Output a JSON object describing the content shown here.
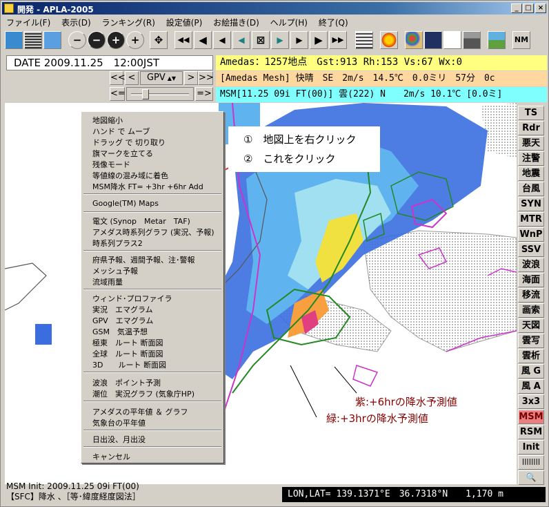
{
  "window": {
    "title": "開発 - APLA-2005"
  },
  "menu": [
    "ファイル(F)",
    "表示(D)",
    "ランキング(R)",
    "設定値(P)",
    "お絵描き(D)",
    "ヘルプ(H)",
    "終了(Q)"
  ],
  "toolbar_glyphs": {
    "zoom_out": "−",
    "minus": "−",
    "plus": "+",
    "plus2": "+",
    "center": "✥",
    "first": "◀◀",
    "prev_big": "◀",
    "prev": "◀",
    "prev_small": "◀",
    "stop": "⊠",
    "next_small": "▶",
    "next": "▶",
    "next_big": "▶",
    "last": "▶▶",
    "nm": "NM"
  },
  "date": "DATE 2009.11.25　12:00JST",
  "amedas": {
    "line1": "Amedas：1257地点　Gst:913 Rh:153 Vs:67 Wx:0",
    "line2": "[Amedas Mesh] 快晴　SE　2m/s　14.5℃　0.0ミリ　57分　0c",
    "msm": "MSM[11.25 09i FT(00)] 雲(222) N　　2m/s 10.1℃ [0.0ミ]"
  },
  "gpv": {
    "first": "<<",
    "prev": "<",
    "label": "GPV",
    "next": ">",
    "last": ">>",
    "slider_left": "<=",
    "slider_right": "=>"
  },
  "side_buttons": [
    "TS",
    "Rdr",
    "悪天",
    "注警",
    "地震",
    "台風",
    "SYN",
    "MTR",
    "WnP",
    "SSV",
    "波浪",
    "海面",
    "移流",
    "画索",
    "天図",
    "雲写",
    "雲析",
    "風 G",
    "風 A",
    "3x3",
    "MSM",
    "RSM",
    "Init",
    "||||||||",
    "🔍"
  ],
  "context_menu": {
    "group1": [
      "地図縮小",
      "ハンド で ムーブ",
      "ドラッグ で 切り取り",
      "旗マークを立てる",
      "残像モード",
      "等値線の混み域に着色",
      "MSM降水 FT= +3hr +6hr Add"
    ],
    "group2": [
      "Google(TM) Maps"
    ],
    "group3": [
      "電文 (Synop　Metar　TAF)",
      "アメダス時系列グラフ (実況、予報)",
      "時系列プラス2"
    ],
    "group4": [
      "府県予報、週間予報、注･警報",
      "メッシュ予報",
      "流域雨量"
    ],
    "group5": [
      "ウィンド･プロファイラ",
      "実況　エマグラム",
      "GPV　エマグラム",
      "GSM　気温予想",
      "極東　ルート 断面図",
      "全球　ルート 断面図",
      "3D　　ルート 断面図"
    ],
    "group6": [
      "波浪　ポイント予測",
      "潮位　実況グラフ (気象庁HP)"
    ],
    "group7": [
      "アメダスの平年値 ＆ グラフ",
      "気象台の平年値"
    ],
    "group8": [
      "日出没、月出没"
    ],
    "group9": [
      "キャンセル"
    ]
  },
  "annotations": {
    "step1": "①　地図上を右クリック",
    "step2": "②　これをクリック",
    "purple": "紫:+6hrの降水予測値",
    "green": "緑:+3hrの降水予測値"
  },
  "status": {
    "line1": "MSM Init: 2009.11.25 09i FT(00)",
    "line2": "【SFC】降水 、［等･緯度経度図法］",
    "coord": "LON,LAT= 139.1371°E　36.7318°N　　1,170 m"
  },
  "colors": {
    "accent_red": "#e03030",
    "purple": "#cc33cc",
    "green": "#228822"
  }
}
